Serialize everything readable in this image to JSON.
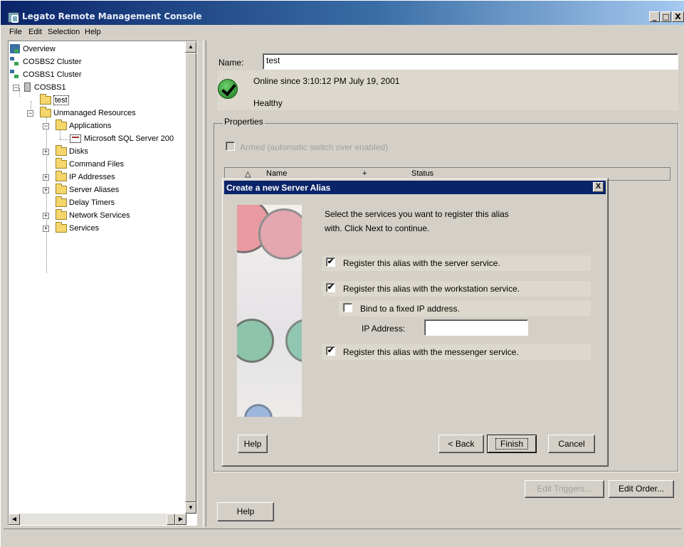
{
  "window": {
    "title": "Legato Remote Management Console",
    "controls": {
      "minimize": "_",
      "maximize": "□",
      "close": "X"
    }
  },
  "menu": [
    "File",
    "Edit",
    "Selection",
    "Help"
  ],
  "tree": {
    "items": [
      {
        "label": "Overview"
      },
      {
        "label": "COSBS2 Cluster"
      },
      {
        "label": "COSBS1 Cluster"
      },
      {
        "label": "COSBS1"
      },
      {
        "label": "test"
      },
      {
        "label": "Unmanaged Resources"
      },
      {
        "label": "Applications"
      },
      {
        "label": "Microsoft SQL Server 200"
      },
      {
        "label": "Disks"
      },
      {
        "label": "Command Files"
      },
      {
        "label": "IP Addresses"
      },
      {
        "label": "Server Aliases"
      },
      {
        "label": "Delay Timers"
      },
      {
        "label": "Network Services"
      },
      {
        "label": "Services"
      }
    ]
  },
  "detail": {
    "name_label": "Name:",
    "name_value": "test",
    "online_text": "Online since 3:10:12 PM July 19, 2001",
    "health_text": "Healthy",
    "properties_title": "Properties",
    "armed_label": "Armed (automatic switch over enabled)",
    "table_columns": [
      "△",
      "Name",
      "+",
      "Status"
    ],
    "edit_triggers_label": "Edit Triggers...",
    "edit_order_label": "Edit Order...",
    "help_label": "Help"
  },
  "dialog": {
    "title": "Create a new Server Alias",
    "close": "X",
    "instructions_line1": "Select the services you want to register this alias",
    "instructions_line2": "with.  Click Next to continue.",
    "options": {
      "server": {
        "label": "Register this alias with the server service.",
        "checked": true,
        "mark": "✔"
      },
      "workstation": {
        "label": "Register this alias with the workstation service.",
        "checked": true,
        "mark": "✔"
      },
      "bind_ip": {
        "label": "Bind to a fixed IP address.",
        "checked": false,
        "mark": ""
      },
      "messenger": {
        "label": "Register this alias with the messenger service.",
        "checked": true,
        "mark": "✔"
      }
    },
    "ip_label": "IP Address:",
    "ip_value": "",
    "buttons": {
      "help": "Help",
      "back": "< Back",
      "finish": "Finish",
      "cancel": "Cancel"
    }
  }
}
